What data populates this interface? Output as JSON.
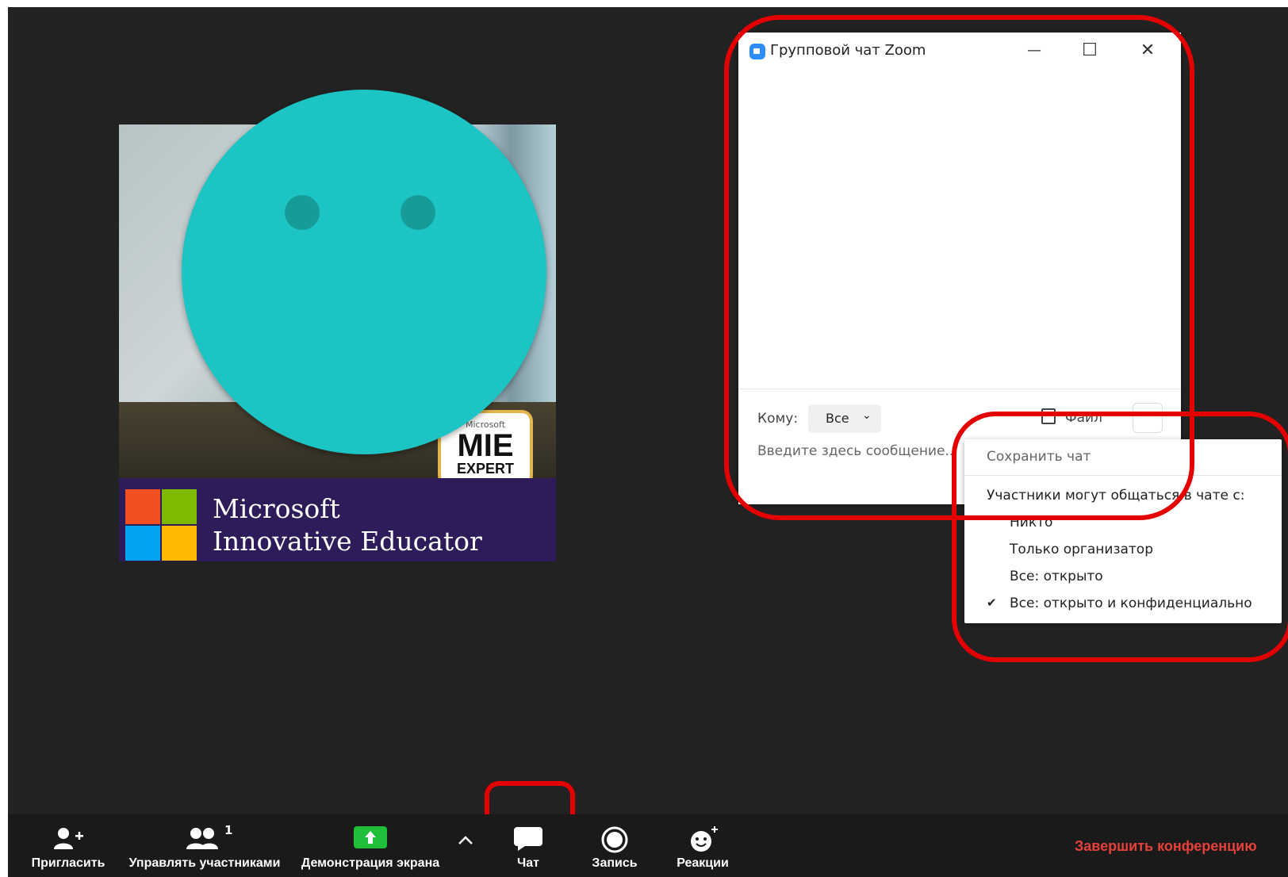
{
  "chat_window": {
    "title": "Групповой чат Zoom",
    "minimize": "—",
    "maximize": "☐",
    "close": "✕",
    "to_label": "Кому:",
    "to_value": "Все",
    "file_label": "Файл",
    "more_label": "···",
    "input_placeholder": "Введите здесь сообщение..."
  },
  "menu": {
    "save_chat": "Сохранить чат",
    "section_label": "Участники могут общаться в чате с:",
    "options": [
      {
        "label": "Никто",
        "checked": false
      },
      {
        "label": "Только организатор",
        "checked": false
      },
      {
        "label": "Все: открыто",
        "checked": false
      },
      {
        "label": "Все: открыто и конфиденциально",
        "checked": true
      }
    ],
    "check_mark": "✔"
  },
  "video_tile": {
    "banner_line1": "Microsoft",
    "banner_line2": "Innovative Educator",
    "badge_small": "Microsoft",
    "badge_mie": "MIE",
    "badge_expert": "EXPERT"
  },
  "toolbar": {
    "invite": "Пригласить",
    "manage": "Управлять участниками",
    "participant_count": "1",
    "share": "Демонстрация экрана",
    "chat": "Чат",
    "record": "Запись",
    "reactions": "Реакции",
    "end": "Завершить конференцию"
  },
  "colors": {
    "meeting_bg": "#222222",
    "toolbar_bg": "#1a1a1a",
    "share_green": "#1fbe3b",
    "end_red": "#e8403a",
    "annotation_red": "#e40000",
    "avatar_teal": "#1dc4c4",
    "zoom_blue": "#2d8cff"
  }
}
